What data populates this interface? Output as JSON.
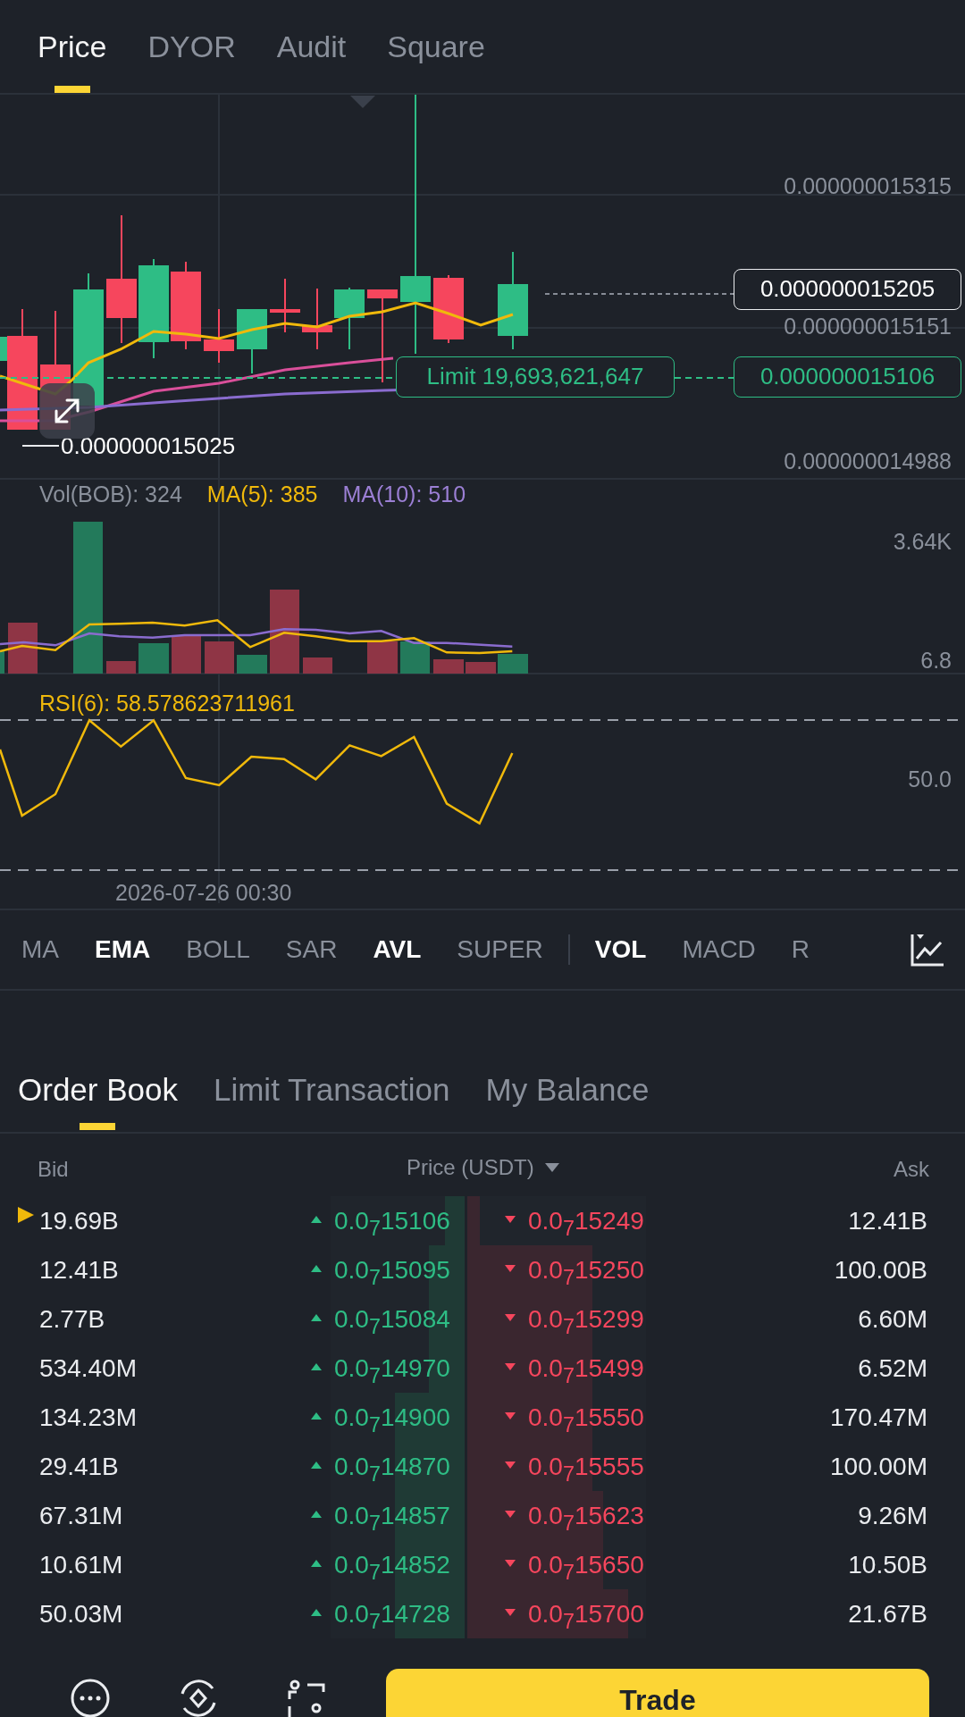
{
  "tabs": [
    {
      "label": "Price",
      "selected": true
    },
    {
      "label": "DYOR",
      "selected": false
    },
    {
      "label": "Audit",
      "selected": false
    },
    {
      "label": "Square",
      "selected": false
    }
  ],
  "price_chart": {
    "axis_labels": [
      "0.000000015315",
      "0.000000015151",
      "0.000000014988"
    ],
    "current_price": "0.000000015205",
    "limit_label": "Limit 19,693,621,647",
    "limit_price": "0.000000015106",
    "low_label": "0.000000015025"
  },
  "volume": {
    "legend": [
      {
        "text": "Vol(BOB): 324",
        "color": "#8a909b"
      },
      {
        "text": "MA(5): 385",
        "color": "#f0b90b"
      },
      {
        "text": "MA(10): 510",
        "color": "#9b7fd4"
      }
    ],
    "axis_labels": [
      "3.64K",
      "6.8"
    ]
  },
  "rsi": {
    "legend": "RSI(6): 58.578623711961",
    "axis_label": "50.0"
  },
  "time_label": "2026-07-26 00:30",
  "main_indicators": [
    {
      "label": "MA",
      "selected": false
    },
    {
      "label": "EMA",
      "selected": true
    },
    {
      "label": "BOLL",
      "selected": false
    },
    {
      "label": "SAR",
      "selected": false
    },
    {
      "label": "AVL",
      "selected": true
    },
    {
      "label": "SUPER",
      "selected": false
    }
  ],
  "sub_indicators": [
    {
      "label": "VOL",
      "selected": true
    },
    {
      "label": "MACD",
      "selected": false
    },
    {
      "label": "R",
      "selected": false
    }
  ],
  "order_tabs": [
    {
      "label": "Order Book",
      "selected": true
    },
    {
      "label": "Limit Transaction",
      "selected": false
    },
    {
      "label": "My Balance",
      "selected": false
    }
  ],
  "order_book": {
    "columns": [
      "Bid",
      "Price (USDT)",
      "Ask"
    ],
    "rows": [
      {
        "marked": true,
        "bid": "19.69B",
        "bid_price": "0.0$_{7}$15106",
        "ask_price": "0.0$_{7}$15249",
        "ask": "12.41B",
        "bid_depth": {
          "level": 0.15
        },
        "ask_depth": {
          "level": 0.07
        }
      },
      {
        "marked": false,
        "bid": "12.41B",
        "bid_price": "0.0$_{7}$15095",
        "ask_price": "0.0$_{7}$15250",
        "ask": "100.00B",
        "bid_depth": {
          "level": 0.27
        },
        "ask_depth": {
          "level": 0.7
        }
      },
      {
        "marked": false,
        "bid": "2.77B",
        "bid_price": "0.0$_{7}$15084",
        "ask_price": "0.0$_{7}$15299",
        "ask": "6.60M",
        "bid_depth": {
          "level": 0.27
        },
        "ask_depth": {
          "level": 0.7
        }
      },
      {
        "marked": false,
        "bid": "534.40M",
        "bid_price": "0.0$_{7}$14970",
        "ask_price": "0.0$_{7}$15499",
        "ask": "6.52M",
        "bid_depth": {
          "level": 0.27
        },
        "ask_depth": {
          "level": 0.7
        }
      },
      {
        "marked": false,
        "bid": "134.23M",
        "bid_price": "0.0$_{7}$14900",
        "ask_price": "0.0$_{7}$15550",
        "ask": "170.47M",
        "bid_depth": {
          "level": 0.52
        },
        "ask_depth": {
          "level": 0.7
        }
      },
      {
        "marked": false,
        "bid": "29.41B",
        "bid_price": "0.0$_{7}$14870",
        "ask_price": "0.0$_{7}$15555",
        "ask": "100.00M",
        "bid_depth": {
          "level": 0.52
        },
        "ask_depth": {
          "level": 0.7
        }
      },
      {
        "marked": false,
        "bid": "67.31M",
        "bid_price": "0.0$_{7}$14857",
        "ask_price": "0.0$_{7}$15623",
        "ask": "9.26M",
        "bid_depth": {
          "level": 0.52
        },
        "ask_depth": {
          "level": 0.76
        }
      },
      {
        "marked": false,
        "bid": "10.61M",
        "bid_price": "0.0$_{7}$14852",
        "ask_price": "0.0$_{7}$15650",
        "ask": "10.50B",
        "bid_depth": {
          "level": 0.52
        },
        "ask_depth": {
          "level": 0.76
        }
      },
      {
        "marked": false,
        "bid": "50.03M",
        "bid_price": "0.0$_{7}$14728",
        "ask_price": "0.0$_{7}$15700",
        "ask": "21.67B",
        "bid_depth": {
          "level": 0.52
        },
        "ask_depth": {
          "level": 0.9
        }
      }
    ]
  },
  "trade_button": "Trade"
}
